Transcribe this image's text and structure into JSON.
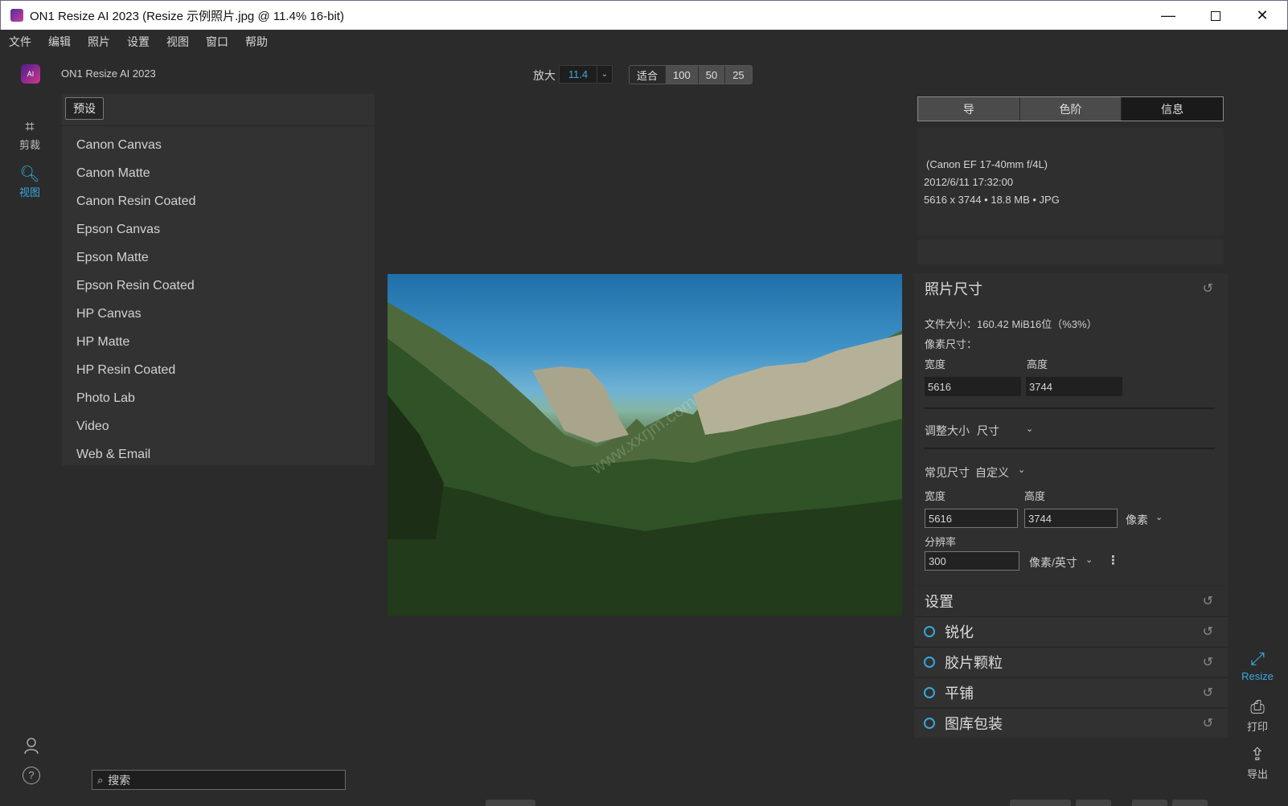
{
  "window": {
    "title": "ON1 Resize AI 2023 (Resize 示例照片.jpg @ 11.4% 16-bit)",
    "minimize_glyph": "—",
    "close_glyph": "✕"
  },
  "menu": [
    "文件",
    "编辑",
    "照片",
    "设置",
    "视图",
    "窗口",
    "帮助"
  ],
  "header": {
    "logo_text": "AI",
    "app_name": "ON1 Resize AI 2023",
    "zoom_label": "放大",
    "zoom_value": "11.4",
    "zoom_presets": [
      "适合",
      "100",
      "50",
      "25"
    ]
  },
  "left_tools": {
    "crop_label": "剪裁",
    "view_label": "视图"
  },
  "presets": {
    "tab_label": "预设",
    "items": [
      "Canon Canvas",
      "Canon Matte",
      "Canon Resin Coated",
      "Epson Canvas",
      "Epson Matte",
      "Epson Resin Coated",
      "HP Canvas",
      "HP Matte",
      "HP Resin Coated",
      "Photo Lab",
      "Video",
      "Web & Email"
    ]
  },
  "search": {
    "placeholder": "搜索"
  },
  "photo": {
    "watermark": "www.xxrjm.com"
  },
  "info_tabs": [
    "导",
    "色阶",
    "信息"
  ],
  "info": {
    "lens": "(Canon EF 17-40mm f/4L)",
    "datetime": "2012/6/11  17:32:00",
    "summary": "5616 x 3744 • 18.8 MB • JPG"
  },
  "photo_size": {
    "title": "照片尺寸",
    "file_size": "文件大小：160.42 MiB16位（%3%）",
    "pixel_size_label": "像素尺寸：",
    "width_label": "宽度",
    "height_label": "高度",
    "pixel_width": "5616",
    "pixel_height": "3744",
    "resize_label": "调整大小",
    "resize_mode": "尺寸",
    "common_size_label": "常见尺寸",
    "common_size_value": "自定义",
    "width_label2": "宽度",
    "height_label2": "高度",
    "width_value": "5616",
    "height_value": "3744",
    "unit": "像素",
    "resolution_label": "分辨率",
    "resolution_value": "300",
    "resolution_unit": "像素/英寸"
  },
  "settings": {
    "title": "设置",
    "items": [
      "锐化",
      "胶片颗粒",
      "平铺",
      "图库包装"
    ]
  },
  "right_tools": {
    "resize_label": "Resize",
    "print_label": "打印",
    "export_label": "导出"
  },
  "colors": {
    "accent": "#39a7dc",
    "background": "#2b2b2b",
    "panel": "#323232"
  }
}
